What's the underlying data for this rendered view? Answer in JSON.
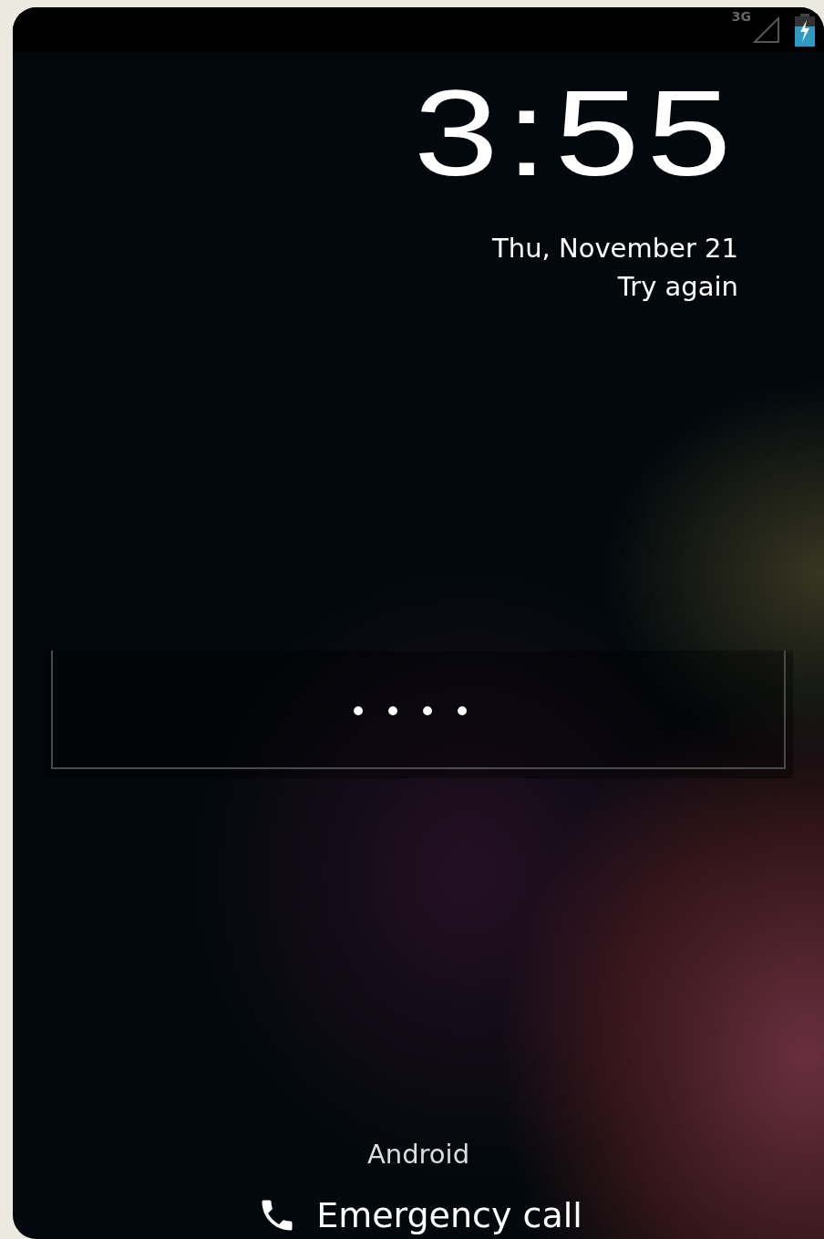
{
  "status_bar": {
    "network": "3G"
  },
  "clock": {
    "time": "3:55",
    "date": "Thu, November 21",
    "message": "Try again"
  },
  "pin_field": {
    "value": "••••"
  },
  "carrier": "Android",
  "emergency_button": {
    "label": "Emergency call"
  }
}
